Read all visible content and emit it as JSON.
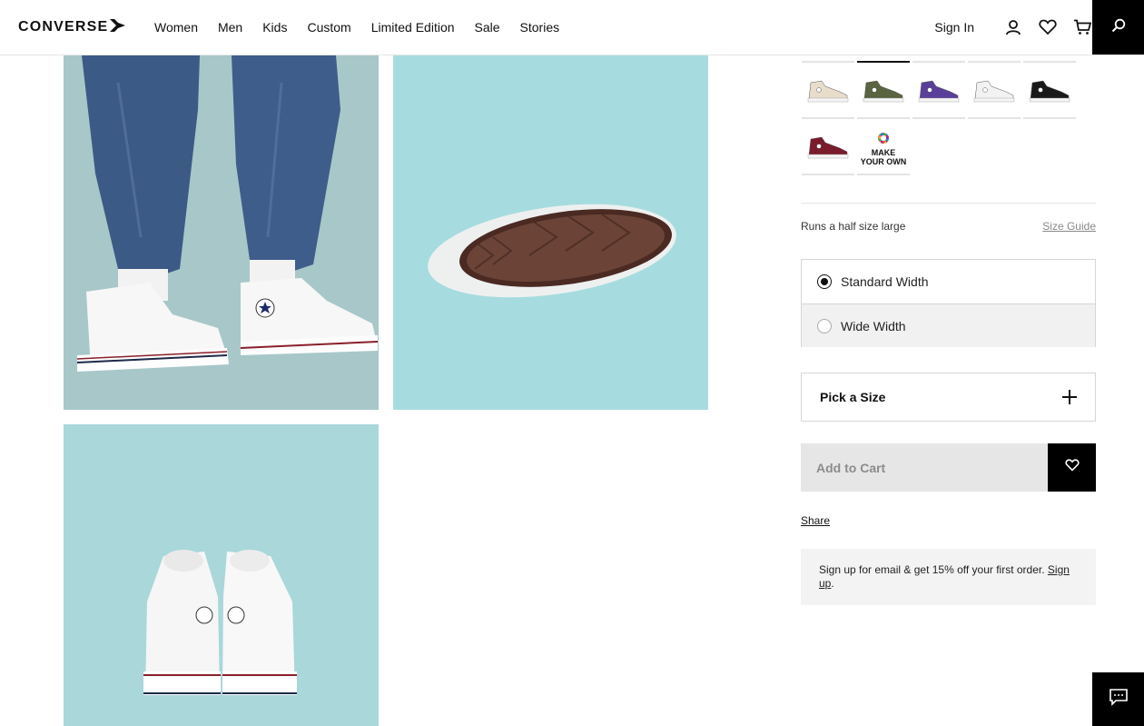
{
  "header": {
    "logo_text": "CONVERSE",
    "nav": [
      "Women",
      "Men",
      "Kids",
      "Custom",
      "Limited Edition",
      "Sale",
      "Stories"
    ],
    "sign_in": "Sign In"
  },
  "product": {
    "swatches": [
      {
        "name": "natural-ivory",
        "color": "#e8dccb"
      },
      {
        "name": "khaki-green",
        "color": "#5a6441"
      },
      {
        "name": "purple",
        "color": "#5a3f9a"
      },
      {
        "name": "white",
        "color": "#f2f2f2"
      },
      {
        "name": "black",
        "color": "#1a1a1a"
      },
      {
        "name": "maroon",
        "color": "#7a1c2c"
      }
    ],
    "make_your_own_line1": "MAKE",
    "make_your_own_line2": "YOUR OWN",
    "fit_note": "Runs a half size large",
    "size_guide": "Size Guide",
    "width_options": [
      "Standard Width",
      "Wide Width"
    ],
    "selected_width": "Standard Width",
    "size_picker_label": "Pick a Size",
    "add_to_cart": "Add to Cart",
    "share": "Share",
    "promo_text": "Sign up for email & get 15% off your first order.",
    "promo_link": "Sign up",
    "promo_period": "."
  }
}
